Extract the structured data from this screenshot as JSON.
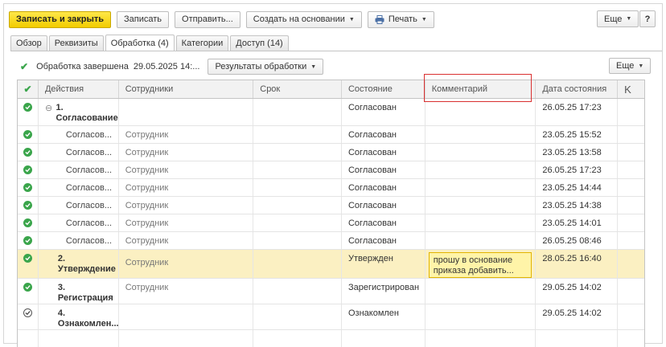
{
  "toolbar": {
    "save_close_label": "Записать и закрыть",
    "save_label": "Записать",
    "send_label": "Отправить...",
    "create_based_label": "Создать на основании",
    "print_label": "Печать",
    "more_label": "Еще",
    "help_label": "?"
  },
  "tabs": [
    {
      "label": "Обзор"
    },
    {
      "label": "Реквизиты"
    },
    {
      "label": "Обработка (4)"
    },
    {
      "label": "Категории"
    },
    {
      "label": "Доступ (14)"
    }
  ],
  "status": {
    "text": "Обработка завершена",
    "date": "29.05.2025 14:...",
    "results_label": "Результаты обработки",
    "more_label": "Еще"
  },
  "table": {
    "columns": [
      "Действия",
      "Сотрудники",
      "Срок",
      "Состояние",
      "Комментарий",
      "Дата состояния",
      "K"
    ],
    "rows": [
      {
        "num": "1.",
        "title": "Согласование",
        "employee": "",
        "term": "",
        "state": "Согласован",
        "comment": "",
        "date": "26.05.25 17:23"
      },
      {
        "num": "",
        "title": "Согласов...",
        "employee": "Сотрудник",
        "term": "",
        "state": "Согласован",
        "comment": "",
        "date": "23.05.25 15:52"
      },
      {
        "num": "",
        "title": "Согласов...",
        "employee": "Сотрудник",
        "term": "",
        "state": "Согласован",
        "comment": "",
        "date": "23.05.25 13:58"
      },
      {
        "num": "",
        "title": "Согласов...",
        "employee": "Сотрудник",
        "term": "",
        "state": "Согласован",
        "comment": "",
        "date": "26.05.25 17:23"
      },
      {
        "num": "",
        "title": "Согласов...",
        "employee": "Сотрудник",
        "term": "",
        "state": "Согласован",
        "comment": "",
        "date": "23.05.25 14:44"
      },
      {
        "num": "",
        "title": "Согласов...",
        "employee": "Сотрудник",
        "term": "",
        "state": "Согласован",
        "comment": "",
        "date": "23.05.25 14:38"
      },
      {
        "num": "",
        "title": "Согласов...",
        "employee": "Сотрудник",
        "term": "",
        "state": "Согласован",
        "comment": "",
        "date": "23.05.25 14:01"
      },
      {
        "num": "",
        "title": "Согласов...",
        "employee": "Сотрудник",
        "term": "",
        "state": "Согласован",
        "comment": "",
        "date": "26.05.25 08:46"
      },
      {
        "num": "2.",
        "title": "Утверждение",
        "employee": "Сотрудник",
        "term": "",
        "state": "Утвержден",
        "comment": "прошу в основание приказа добавить...",
        "date": "28.05.25 16:40"
      },
      {
        "num": "3.",
        "title": "Регистрация",
        "employee": "Сотрудник",
        "term": "",
        "state": "Зарегистрирован",
        "comment": "",
        "date": "29.05.25 14:02"
      },
      {
        "num": "4.",
        "title": "Ознакомлен...",
        "employee": "",
        "term": "",
        "state": "Ознакомлен",
        "comment": "",
        "date": "29.05.25 14:02"
      }
    ]
  },
  "colors": {
    "primary_button": "#f2cc00",
    "check_green": "#3aa54b",
    "selected_row": "#fbf0c2",
    "comment_highlight": "#d93030"
  }
}
